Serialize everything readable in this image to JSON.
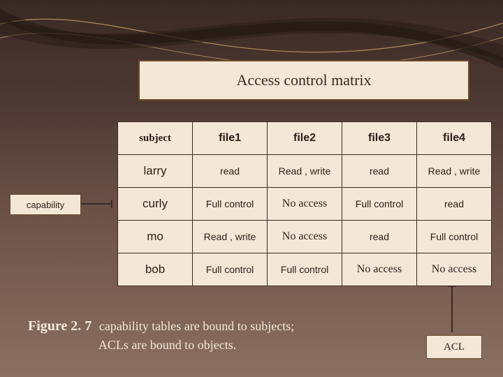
{
  "title": "Access control matrix",
  "headers": {
    "subject": "subject",
    "file1": "file1",
    "file2": "file2",
    "file3": "file3",
    "file4": "file4"
  },
  "rows": [
    {
      "subject": "larry",
      "file1": "read",
      "file2": "Read , write",
      "file3": "read",
      "file4": "Read , write"
    },
    {
      "subject": "curly",
      "file1": "Full control",
      "file2": "No access",
      "file3": "Full control",
      "file4": "read"
    },
    {
      "subject": "mo",
      "file1": "Read , write",
      "file2": "No access",
      "file3": "read",
      "file4": "Full control"
    },
    {
      "subject": "bob",
      "file1": "Full control",
      "file2": "Full control",
      "file3": "No access",
      "file4": "No access"
    }
  ],
  "side_labels": {
    "capability": "capability",
    "acl": "ACL"
  },
  "caption": {
    "fignum": "Figure 2. 7",
    "text_line1": "capability tables  are bound to subjects;",
    "text_line2": "ACLs are bound to objects."
  },
  "chart_data": {
    "type": "table",
    "title": "Access control matrix",
    "columns": [
      "subject",
      "file1",
      "file2",
      "file3",
      "file4"
    ],
    "rows": [
      [
        "larry",
        "read",
        "Read , write",
        "read",
        "Read , write"
      ],
      [
        "curly",
        "Full control",
        "No access",
        "Full control",
        "read"
      ],
      [
        "mo",
        "Read , write",
        "No access",
        "read",
        "Full control"
      ],
      [
        "bob",
        "Full control",
        "Full control",
        "No access",
        "No access"
      ]
    ],
    "annotations": {
      "row_label": "capability",
      "column_label": "ACL",
      "caption": "Figure 2.7 capability tables are bound to subjects; ACLs are bound to objects."
    }
  }
}
